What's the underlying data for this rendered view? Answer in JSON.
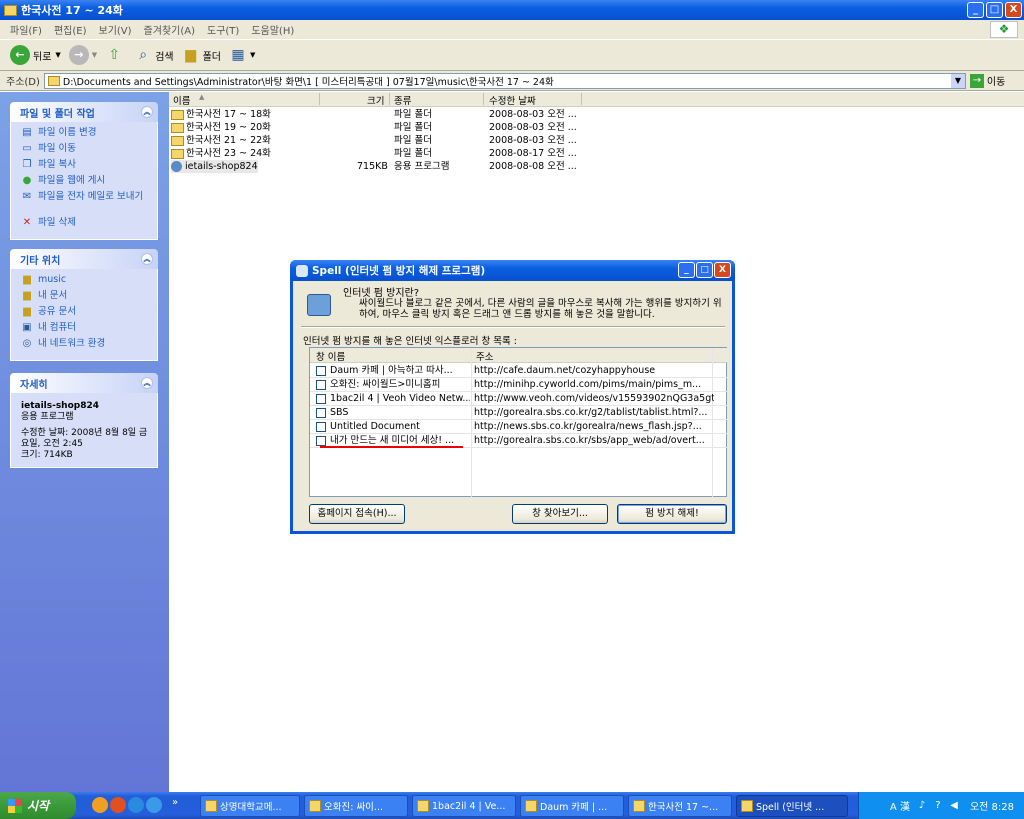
{
  "window": {
    "title": "한국사전 17 ~ 24화",
    "min": "_",
    "max": "□",
    "close": "X"
  },
  "menu": [
    "파일(F)",
    "편집(E)",
    "보기(V)",
    "즐겨찾기(A)",
    "도구(T)",
    "도움말(H)"
  ],
  "toolbar": {
    "back": "뒤로",
    "search": "검색",
    "folders": "폴더"
  },
  "address": {
    "label": "주소(D)",
    "path": "D:\\Documents and Settings\\Administrator\\바탕 화면\\1 [ 미스터리특공대 ] 07월17일\\music\\한국사전 17 ~ 24화",
    "go": "이동"
  },
  "tasks_panel": {
    "title": "파일 및 폴더 작업",
    "items": [
      "파일 이름 변경",
      "파일 이동",
      "파일 복사",
      "파일을 웹에 게시",
      "파일을 전자 메일로 보내기",
      "파일 삭제"
    ]
  },
  "places_panel": {
    "title": "기타 위치",
    "items": [
      "music",
      "내 문서",
      "공유 문서",
      "내 컴퓨터",
      "내 네트워크 환경"
    ]
  },
  "details_panel": {
    "title": "자세히",
    "name": "ietails-shop824",
    "type": "응용 프로그램",
    "modified": "수정한 날짜: 2008년 8월 8일 금요일, 오전 2:45",
    "size": "크기: 714KB"
  },
  "file_list": {
    "columns": [
      "이름",
      "크기",
      "종류",
      "수정한 날짜"
    ],
    "rows": [
      {
        "name": "한국사전 17 ~ 18화",
        "size": "",
        "type": "파일 폴더",
        "date": "2008-08-03 오전 ..."
      },
      {
        "name": "한국사전 19 ~ 20화",
        "size": "",
        "type": "파일 폴더",
        "date": "2008-08-03 오전 ..."
      },
      {
        "name": "한국사전 21 ~ 22화",
        "size": "",
        "type": "파일 폴더",
        "date": "2008-08-03 오전 ..."
      },
      {
        "name": "한국사전 23 ~ 24화",
        "size": "",
        "type": "파일 폴더",
        "date": "2008-08-17 오전 ..."
      },
      {
        "name": "ietails-shop824",
        "size": "715KB",
        "type": "응용 프로그램",
        "date": "2008-08-08 오전 ..."
      }
    ]
  },
  "dialog": {
    "title": "Spell (인터넷 펌 방지 해제 프로그램)",
    "info_title": "인터넷 펌 방지란?",
    "info_desc": "싸이월드나 블로그 같은 곳에서, 다른 사람의 글을 마우스로 복사해 가는 행위를 방지하기 위하여, 마우스 클릭 방지 혹은 드래그 앤 드롭 방지를 해 놓은 것을 말합니다.",
    "list_label": "인터넷 펌 방지를 해 놓은 인터넷 익스플로러 창 목록 :",
    "columns": [
      "창 이름",
      "주소"
    ],
    "rows": [
      {
        "name": "Daum 카페 | 아늑하고 따사...",
        "url": "http://cafe.daum.net/cozyhappyhouse"
      },
      {
        "name": "오화진: 싸이월드>미니홈피",
        "url": "http://minihp.cyworld.com/pims/main/pims_m..."
      },
      {
        "name": "1bac2il 4 | Veoh Video Netw...",
        "url": "http://www.veoh.com/videos/v15593902nQG3a5gt"
      },
      {
        "name": "SBS",
        "url": "http://gorealra.sbs.co.kr/g2/tablist/tablist.html?..."
      },
      {
        "name": "Untitled Document",
        "url": "http://news.sbs.co.kr/gorealra/news_flash.jsp?..."
      },
      {
        "name": "내가 만드는 새 미디어 세상! ...",
        "url": "http://gorealra.sbs.co.kr/sbs/app_web/ad/overt..."
      }
    ],
    "btn_home": "홈페이지 접속(H)...",
    "btn_find": "창 찾아보기...",
    "btn_release": "펌 방지 해제!"
  },
  "taskbar": {
    "start": "시작",
    "tasks": [
      "상명대학교메...",
      "오화진: 싸이...",
      "1bac2il 4 | Ve...",
      "Daum 카페 | ...",
      "한국사전 17 ~...",
      "Spell (인터넷 ..."
    ],
    "clock": "오전 8:28",
    "ime": "A 漢"
  }
}
